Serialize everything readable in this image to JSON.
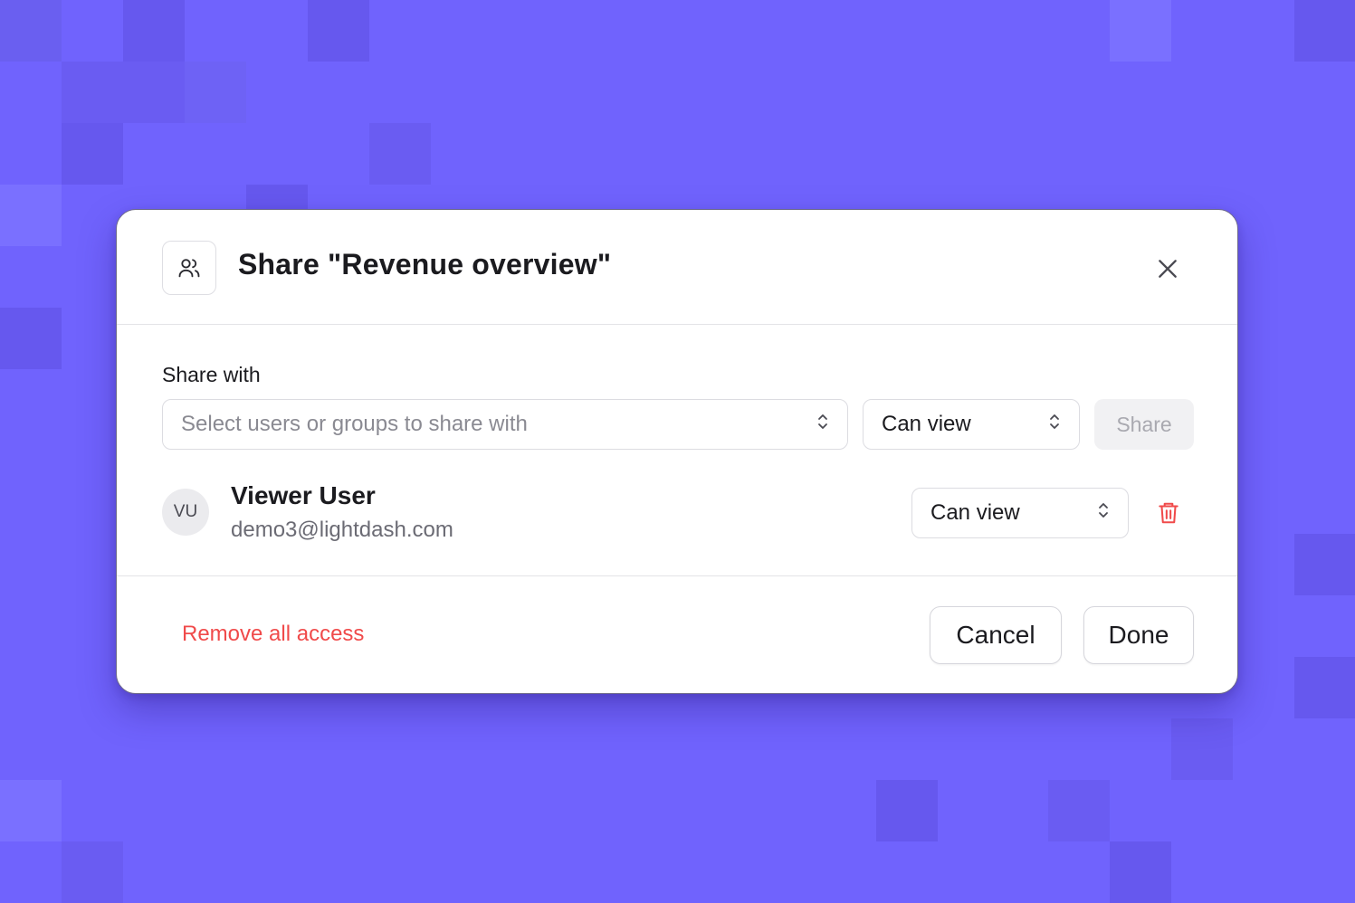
{
  "background": {
    "color": "#7063fd",
    "tile_colors": [
      "#6a5cf2",
      "#7a70ff",
      "#6658ee"
    ]
  },
  "modal": {
    "title": "Share \"Revenue overview\"",
    "header_icon": "users-icon",
    "close_icon": "close-icon"
  },
  "share_with": {
    "label": "Share with",
    "users_select_placeholder": "Select users or groups to share with",
    "permission_value": "Can view",
    "share_button": "Share"
  },
  "shared_users": [
    {
      "initials": "VU",
      "name": "Viewer User",
      "email": "demo3@lightdash.com",
      "permission": "Can view",
      "delete_icon": "trash-icon"
    }
  ],
  "footer": {
    "remove_all_label": "Remove all access",
    "cancel_label": "Cancel",
    "done_label": "Done"
  },
  "colors": {
    "danger": "#f04a4a",
    "text": "#1b1b1f",
    "muted": "#6b6b74"
  }
}
